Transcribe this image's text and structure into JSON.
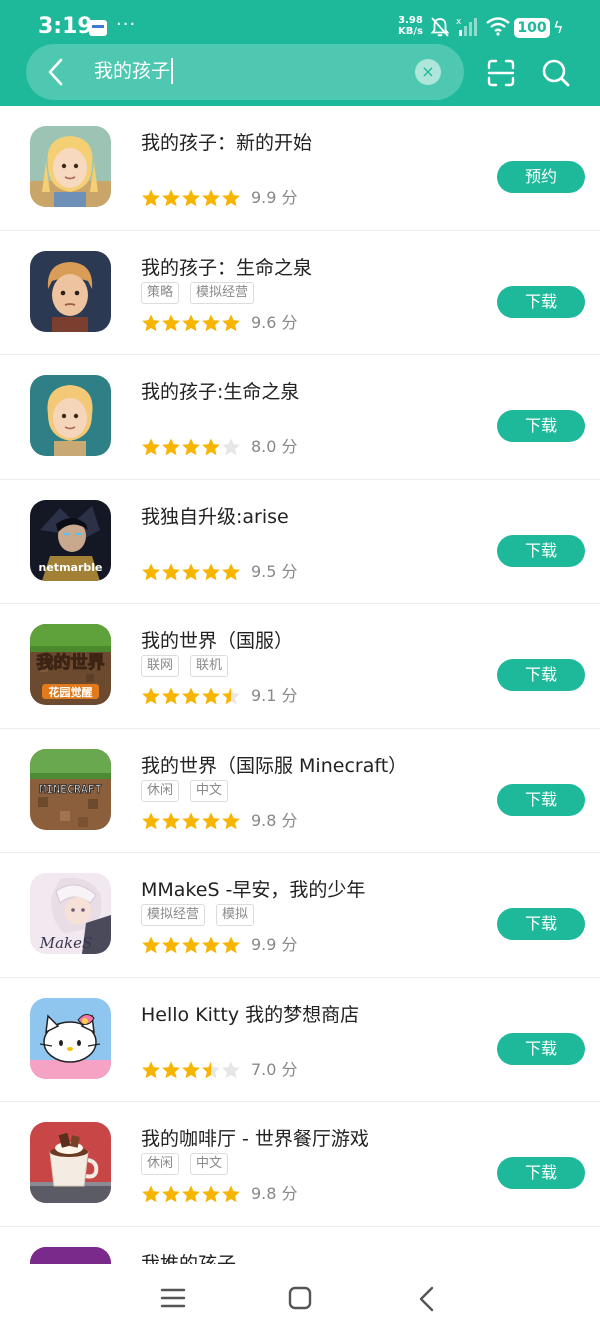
{
  "status_bar": {
    "time": "3:19",
    "speed_value": "3.98",
    "speed_unit": "KB/s",
    "battery": "100"
  },
  "search": {
    "query": "我的孩子",
    "clear_symbol": "×"
  },
  "colors": {
    "accent": "#1db99a",
    "star": "#f7b500",
    "star_empty": "#e6e6e6"
  },
  "rating_unit": "分",
  "apps": [
    {
      "title": "我的孩子：新的开始",
      "tags": [],
      "rating": 5,
      "score": "9.9",
      "button": "预约",
      "icon": "girl-avatar-icon"
    },
    {
      "title": "我的孩子：生命之泉",
      "tags": [
        "策略",
        "模拟经营"
      ],
      "rating": 5,
      "score": "9.6",
      "button": "下载",
      "icon": "boy-avatar-icon"
    },
    {
      "title": "我的孩子:生命之泉",
      "tags": [],
      "rating": 4,
      "score": "8.0",
      "button": "下载",
      "icon": "girl-avatar-icon"
    },
    {
      "title": "我独自升级:arise",
      "tags": [],
      "rating": 5,
      "score": "9.5",
      "button": "下载",
      "icon": "netmarble-icon",
      "icon_text": "netmarble"
    },
    {
      "title": "我的世界（国服）",
      "tags": [
        "联网",
        "联机"
      ],
      "rating": 4.5,
      "score": "9.1",
      "button": "下载",
      "icon": "minecraft-cn-icon",
      "icon_text": "我的世界",
      "icon_subtext": "花园觉醒"
    },
    {
      "title": "我的世界（国际服 Minecraft）",
      "tags": [
        "休闲",
        "中文"
      ],
      "rating": 5,
      "score": "9.8",
      "button": "下载",
      "icon": "minecraft-icon",
      "icon_text": "MINECRAFT"
    },
    {
      "title": "MMakeS -早安，我的少年",
      "tags": [
        "模拟经营",
        "模拟"
      ],
      "rating": 5,
      "score": "9.9",
      "button": "下载",
      "icon": "mmakes-icon",
      "icon_text": "MakeS"
    },
    {
      "title": "Hello Kitty 我的梦想商店",
      "tags": [],
      "rating": 3.5,
      "score": "7.0",
      "button": "下载",
      "icon": "hello-kitty-icon"
    },
    {
      "title": "我的咖啡厅 - 世界餐厅游戏",
      "tags": [
        "休闲",
        "中文"
      ],
      "rating": 5,
      "score": "9.8",
      "button": "下载",
      "icon": "coffee-cup-icon"
    },
    {
      "title": "我推的孩子",
      "tags": [],
      "rating": 0,
      "score": "",
      "button": "",
      "icon": "oshi-no-ko-icon"
    }
  ]
}
